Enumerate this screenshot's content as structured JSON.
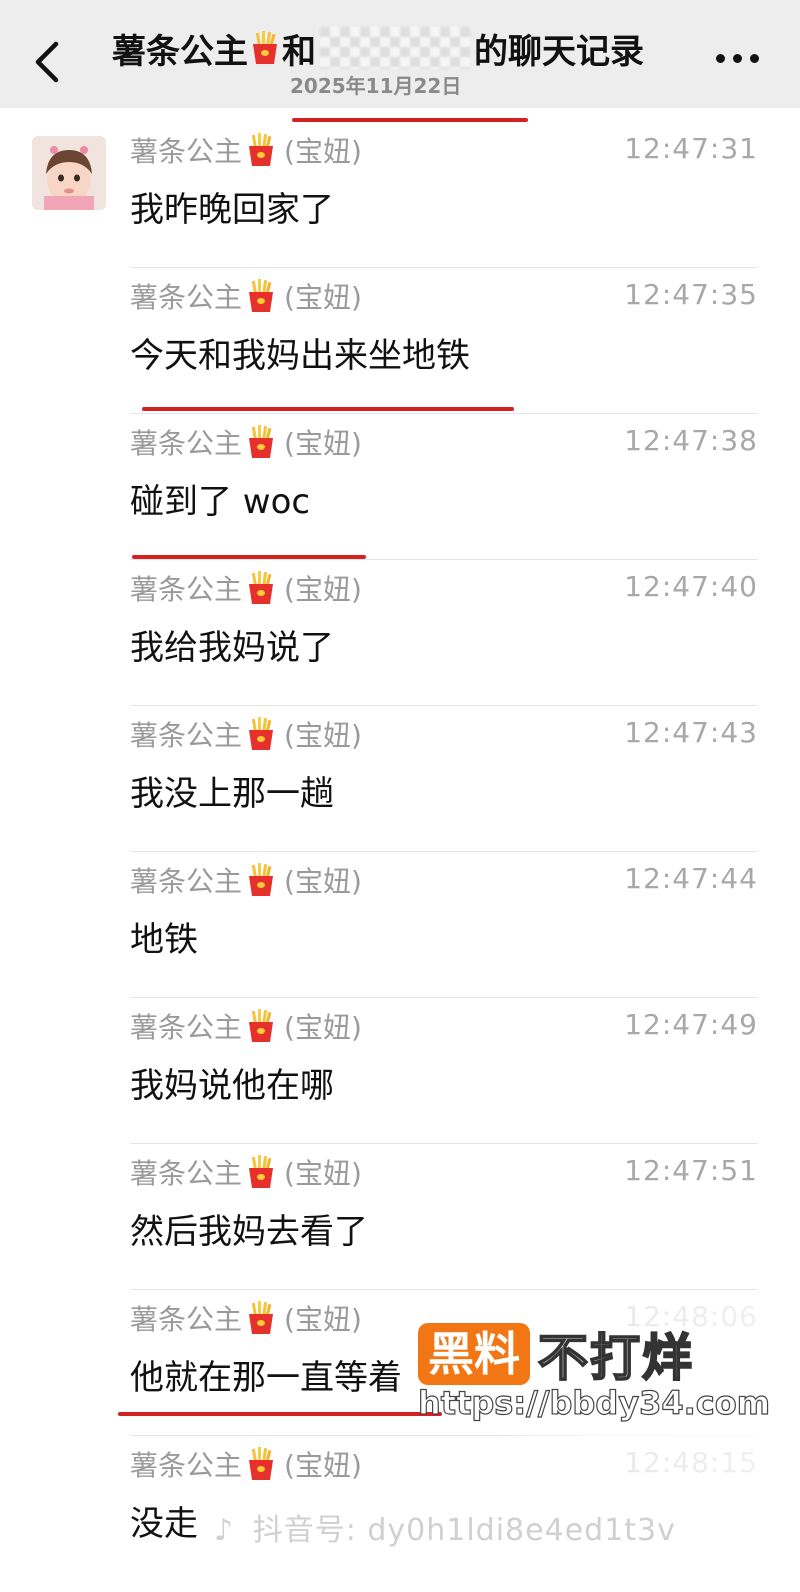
{
  "header": {
    "title_prefix": "薯条公主",
    "title_join": "和",
    "title_suffix": "的聊天记录",
    "date": "2025年11月22日",
    "more": "..."
  },
  "icons": {
    "back": "chevron-left-icon",
    "fries": "french-fries-emoji-icon",
    "more": "more-dots-icon"
  },
  "messages": [
    {
      "sender": "薯条公主",
      "nickname": "(宝妞)",
      "time": "12:47:31",
      "text": "我昨晚回家了"
    },
    {
      "sender": "薯条公主",
      "nickname": "(宝妞)",
      "time": "12:47:35",
      "text": "今天和我妈出来坐地铁"
    },
    {
      "sender": "薯条公主",
      "nickname": "(宝妞)",
      "time": "12:47:38",
      "text": "碰到了 woc"
    },
    {
      "sender": "薯条公主",
      "nickname": "(宝妞)",
      "time": "12:47:40",
      "text": "我给我妈说了"
    },
    {
      "sender": "薯条公主",
      "nickname": "(宝妞)",
      "time": "12:47:43",
      "text": "我没上那一趟"
    },
    {
      "sender": "薯条公主",
      "nickname": "(宝妞)",
      "time": "12:47:44",
      "text": "地铁"
    },
    {
      "sender": "薯条公主",
      "nickname": "(宝妞)",
      "time": "12:47:49",
      "text": "我妈说他在哪"
    },
    {
      "sender": "薯条公主",
      "nickname": "(宝妞)",
      "time": "12:47:51",
      "text": "然后我妈去看了"
    },
    {
      "sender": "薯条公主",
      "nickname": "(宝妞)",
      "time": "12:48:06",
      "text": "他就在那一直等着"
    },
    {
      "sender": "薯条公主",
      "nickname": "(宝妞)",
      "time": "12:48:15",
      "text": "没走"
    }
  ],
  "watermark": {
    "logo_box": "黑料",
    "logo_text": "不打烊",
    "url": "https://bbdy34.com",
    "douyin_label": "抖音号:",
    "douyin_id": "dy0h1ldi8e4ed1t3v"
  },
  "colors": {
    "header_bg": "#ededed",
    "annotation_red": "#d42121",
    "watermark_orange": "#f27613"
  }
}
